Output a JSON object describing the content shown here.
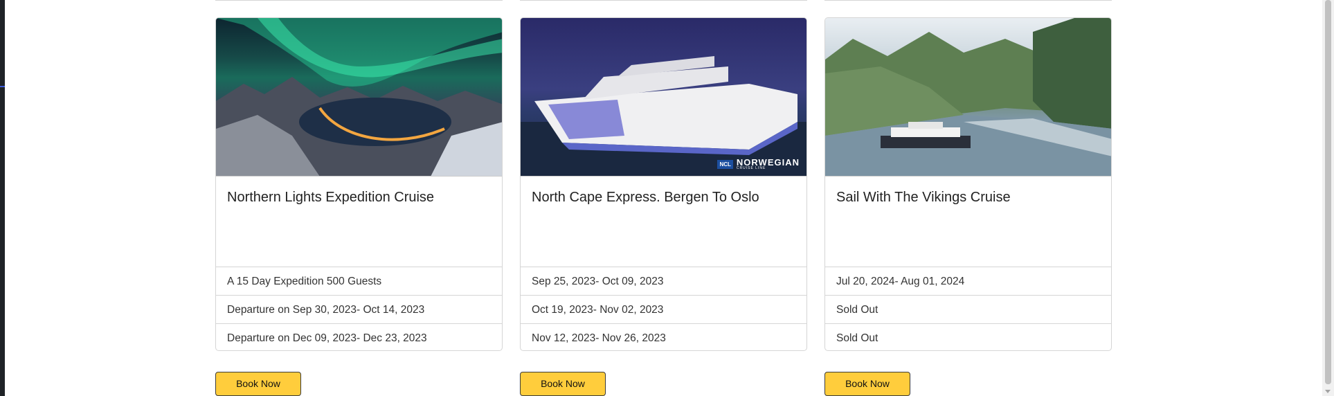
{
  "cards": [
    {
      "title": "Northern Lights Expedition Cruise",
      "image_alt": "aurora-over-fjord-image",
      "items": [
        "A 15 Day Expedition 500 Guests",
        "Departure on Sep 30, 2023- Oct 14, 2023",
        "Departure on Dec 09, 2023- Dec 23, 2023"
      ],
      "button": "Book Now"
    },
    {
      "title": "North Cape Express. Bergen To Oslo",
      "image_alt": "cruise-ship-image",
      "image_logo_text": "NORWEGIAN",
      "image_logo_sub": "CRUISE LINE",
      "image_logo_badge": "NCL",
      "items": [
        "Sep 25, 2023- Oct 09, 2023",
        "Oct 19, 2023- Nov 02, 2023",
        "Nov 12, 2023- Nov 26, 2023"
      ],
      "button": "Book Now"
    },
    {
      "title": "Sail With The Vikings Cruise",
      "image_alt": "fjord-ship-image",
      "items": [
        "Jul 20, 2024- Aug 01, 2024",
        "Sold Out",
        "Sold Out"
      ],
      "button": "Book Now"
    }
  ],
  "colors": {
    "button_bg": "#ffcd3c",
    "border": "#d5d5d5"
  }
}
